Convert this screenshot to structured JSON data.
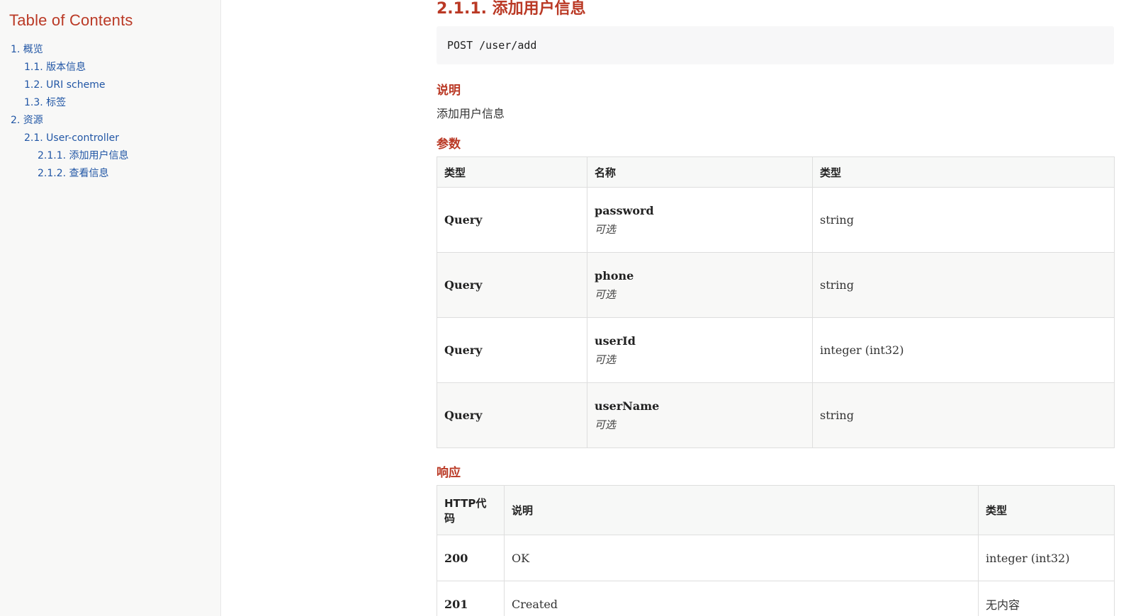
{
  "sidebar": {
    "title": "Table of Contents",
    "items": [
      {
        "label": "1. 概览",
        "level": 1
      },
      {
        "label": "1.1. 版本信息",
        "level": 2
      },
      {
        "label": "1.2. URI scheme",
        "level": 2
      },
      {
        "label": "1.3. 标签",
        "level": 2
      },
      {
        "label": "2. 资源",
        "level": 1
      },
      {
        "label": "2.1. User-controller",
        "level": 2
      },
      {
        "label": "2.1.1. 添加用户信息",
        "level": 3
      },
      {
        "label": "2.1.2. 查看信息",
        "level": 3
      }
    ]
  },
  "main": {
    "section_title": "2.1.1. 添加用户信息",
    "endpoint": "POST /user/add",
    "description_heading": "说明",
    "description_text": "添加用户信息",
    "params_heading": "参数",
    "params_table": {
      "headers": [
        "类型",
        "名称",
        "类型"
      ],
      "rows": [
        {
          "type": "Query",
          "name": "password",
          "optional": "可选",
          "schema": "string"
        },
        {
          "type": "Query",
          "name": "phone",
          "optional": "可选",
          "schema": "string"
        },
        {
          "type": "Query",
          "name": "userId",
          "optional": "可选",
          "schema": "integer (int32)"
        },
        {
          "type": "Query",
          "name": "userName",
          "optional": "可选",
          "schema": "string"
        }
      ]
    },
    "responses_heading": "响应",
    "responses_table": {
      "headers": [
        "HTTP代码",
        "说明",
        "类型"
      ],
      "rows": [
        {
          "code": "200",
          "description": "OK",
          "schema": "integer (int32)"
        },
        {
          "code": "201",
          "description": "Created",
          "schema": "无内容"
        }
      ]
    }
  },
  "colors": {
    "heading": "#ba3925",
    "link": "#2156a5",
    "sidebar_bg": "#f8f8f7",
    "table_header_bg": "#f7f8f7",
    "code_bg": "#f7f7f8"
  }
}
